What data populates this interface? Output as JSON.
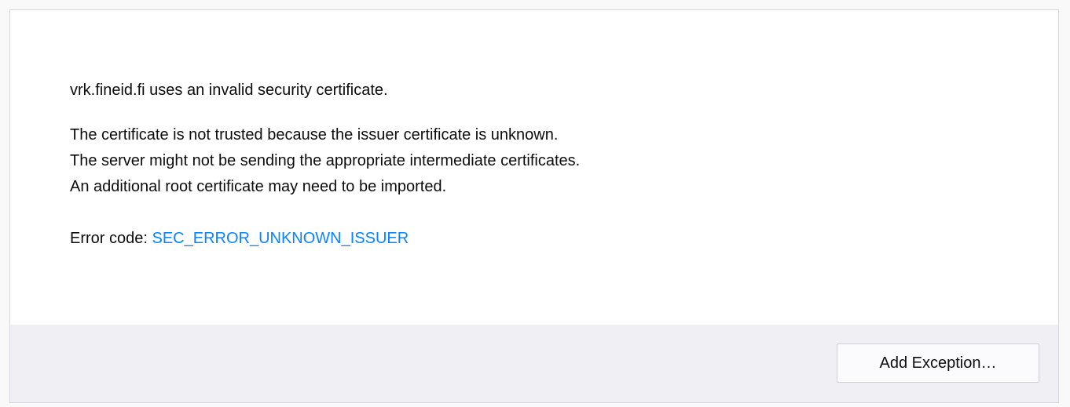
{
  "intro": "vrk.fineid.fi uses an invalid security certificate.",
  "details": [
    "The certificate is not trusted because the issuer certificate is unknown.",
    "The server might not be sending the appropriate intermediate certificates.",
    "An additional root certificate may need to be imported."
  ],
  "error": {
    "label": "Error code: ",
    "code": "SEC_ERROR_UNKNOWN_ISSUER"
  },
  "footer": {
    "add_exception_label": "Add Exception…"
  },
  "colors": {
    "link": "#0a84ff",
    "text": "#0c0c0d",
    "footer_bg": "#f0f0f4"
  }
}
